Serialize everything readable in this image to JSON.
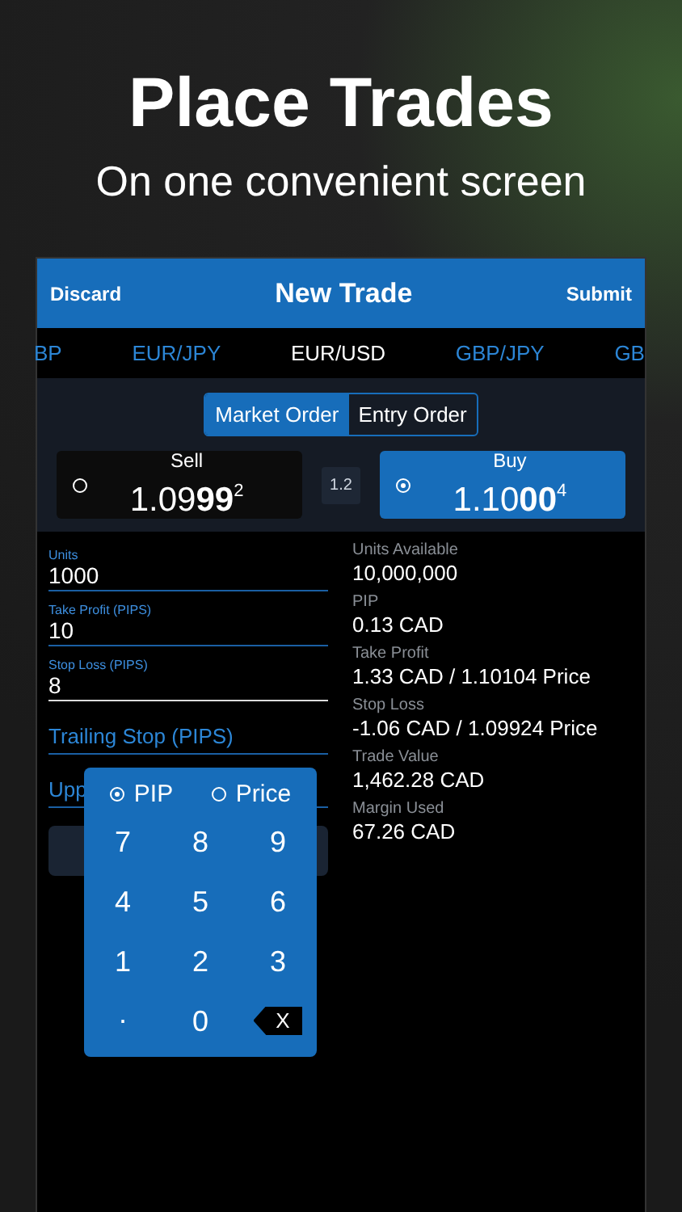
{
  "headline": {
    "title": "Place Trades",
    "subtitle": "On one convenient screen"
  },
  "nav": {
    "left": "Discard",
    "title": "New Trade",
    "right": "Submit"
  },
  "pairs": [
    {
      "label": "BP",
      "selected": false
    },
    {
      "label": "EUR/JPY",
      "selected": false
    },
    {
      "label": "EUR/USD",
      "selected": true
    },
    {
      "label": "GBP/JPY",
      "selected": false
    },
    {
      "label": "GB",
      "selected": false
    }
  ],
  "order_types": [
    {
      "label": "Market Order",
      "selected": true
    },
    {
      "label": "Entry Order",
      "selected": false
    }
  ],
  "quotes": [
    {
      "kind": "quote",
      "label": "Sell",
      "price": "1.09**99**$^{2}$",
      "selected": false
    },
    {
      "kind": "spread",
      "label": "1.2"
    },
    {
      "kind": "quote",
      "label": "Buy",
      "price": "1.10**00**$^{4}$",
      "selected": true
    }
  ],
  "fields": [
    {
      "kind": "filled",
      "label": "Units",
      "value": "1000",
      "focused": false
    },
    {
      "kind": "filled",
      "label": "Take Profit (PIPS)",
      "value": "10",
      "focused": false
    },
    {
      "kind": "filled",
      "label": "Stop Loss (PIPS)",
      "value": "8",
      "focused": true
    },
    {
      "kind": "empty",
      "placeholder": "Trailing Stop (PIPS)",
      "focused": false
    },
    {
      "kind": "empty",
      "placeholder": "Upp",
      "focused": false
    }
  ],
  "details": [
    {
      "label": "Units Available",
      "value": "10,000,000"
    },
    {
      "label": "PIP",
      "value": "0.13 CAD"
    },
    {
      "label": "Take Profit",
      "value": "1.33 CAD / 1.10104 Price"
    },
    {
      "label": "Stop Loss",
      "value": "-1.06 CAD / 1.09924 Price"
    },
    {
      "label": "Trade Value",
      "value": "1,462.28 CAD"
    },
    {
      "label": "Margin Used",
      "value": "67.26 CAD"
    }
  ],
  "keypad": {
    "modes": [
      {
        "label": "PIP",
        "selected": true
      },
      {
        "label": "Price",
        "selected": false
      }
    ],
    "keys": [
      {
        "kind": "digit",
        "label": "7"
      },
      {
        "kind": "digit",
        "label": "8"
      },
      {
        "kind": "digit",
        "label": "9"
      },
      {
        "kind": "digit",
        "label": "4"
      },
      {
        "kind": "digit",
        "label": "5"
      },
      {
        "kind": "digit",
        "label": "6"
      },
      {
        "kind": "digit",
        "label": "1"
      },
      {
        "kind": "digit",
        "label": "2"
      },
      {
        "kind": "digit",
        "label": "3"
      },
      {
        "kind": "point",
        "label": "."
      },
      {
        "kind": "digit",
        "label": "0"
      },
      {
        "kind": "backspace",
        "label": "X"
      }
    ]
  }
}
